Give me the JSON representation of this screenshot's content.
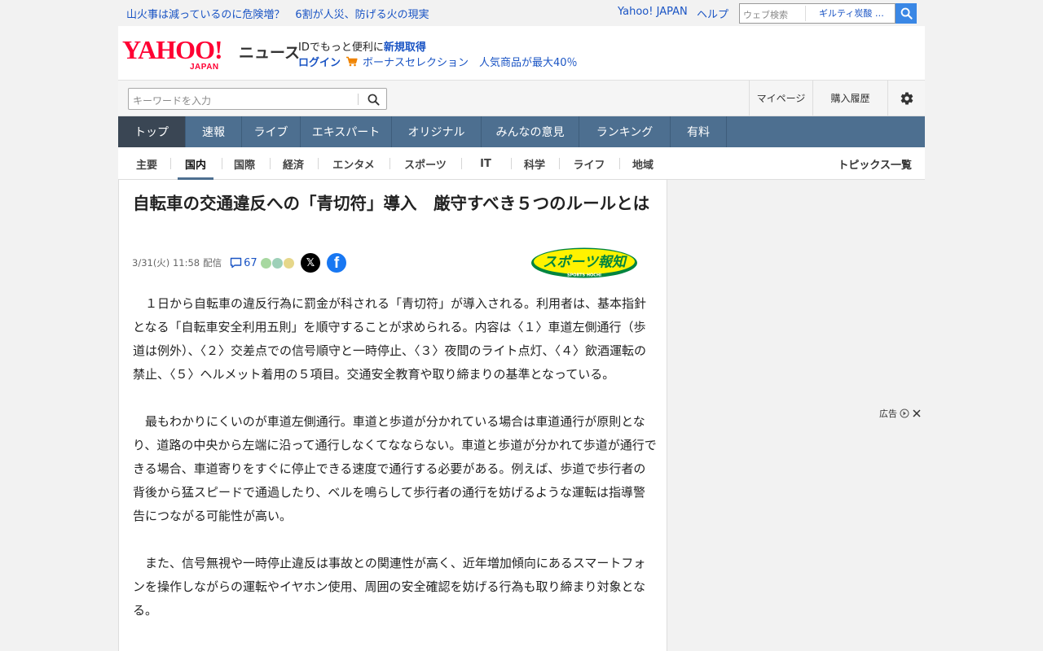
{
  "topbar": {
    "headline_link": "山火事は減っているのに危険増？　6割が人災、防げる火の現実",
    "yahoo_japan": "Yahoo! JAPAN",
    "help": "ヘルプ",
    "search_placeholder": "ウェブ検索",
    "search_suggestion": "ギルティ炭酸 …"
  },
  "header": {
    "logo_yahoo": "YAHOO!",
    "logo_japan": "JAPAN",
    "logo_news": "ニュース",
    "id_text": "IDでもっと便利に",
    "id_link": "新規取得",
    "login": "ログイン",
    "promo": "ボーナスセレクション　人気商品が最大40％"
  },
  "search_row": {
    "keyword_placeholder": "キーワードを入力",
    "mypage": "マイページ",
    "purchase_history": "購入履歴"
  },
  "global_nav": [
    {
      "label": "トップ"
    },
    {
      "label": "速報"
    },
    {
      "label": "ライブ"
    },
    {
      "label": "エキスパート"
    },
    {
      "label": "オリジナル"
    },
    {
      "label": "みんなの意見"
    },
    {
      "label": "ランキング"
    },
    {
      "label": "有料"
    }
  ],
  "sub_nav": [
    {
      "label": "主要"
    },
    {
      "label": "国内"
    },
    {
      "label": "国際"
    },
    {
      "label": "経済"
    },
    {
      "label": "エンタメ"
    },
    {
      "label": "スポーツ"
    },
    {
      "label": "IT"
    },
    {
      "label": "科学"
    },
    {
      "label": "ライフ"
    },
    {
      "label": "地域"
    }
  ],
  "topics_link": "トピックス一覧",
  "article": {
    "title": "自転車の交通違反への「青切符」導入　厳守すべき５つのルールとは",
    "date": "3/31(火) 11:58",
    "delivered": "配信",
    "comment_count": "67",
    "source_logo_text": "スポーツ報知",
    "source_logo_sub": "SPORTS HOCHI",
    "paragraphs": [
      "　１日から自転車の違反行為に罰金が科される「青切符」が導入される。利用者は、基本指針となる「自転車安全利用五則」を順守することが求められる。内容は〈１〉車道左側通行（歩道は例外）、〈２〉交差点での信号順守と一時停止、〈３〉夜間のライト点灯、〈４〉飲酒運転の禁止、〈５〉ヘルメット着用の５項目。交通安全教育や取り締まりの基準となっている。",
      "　最もわかりにくいのが車道左側通行。車道と歩道が分かれている場合は車道通行が原則となり、道路の中央から左端に沿って通行しなくてなならない。車道と歩道が分かれて歩道が通行できる場合、車道寄りをすぐに停止できる速度で通行する必要がある。例えば、歩道で歩行者の背後から猛スピードで通過したり、ベルを鳴らして歩行者の通行を妨げるような運転は指導警告につながる可能性が高い。",
      "　また、信号無視や一時停止違反は事故との関連性が高く、近年増加傾向にあるスマートフォンを操作しながらの運転やイヤホン使用、周囲の安全確認を妨げる行為も取り締まり対象となる。"
    ]
  },
  "ad": {
    "label": "広告"
  },
  "colors": {
    "nav_bg": "#4d6f90",
    "nav_active": "#3a4654",
    "link": "#1a54c4",
    "yahoo_red": "#ff0033",
    "search_btn": "#3a87e5"
  }
}
